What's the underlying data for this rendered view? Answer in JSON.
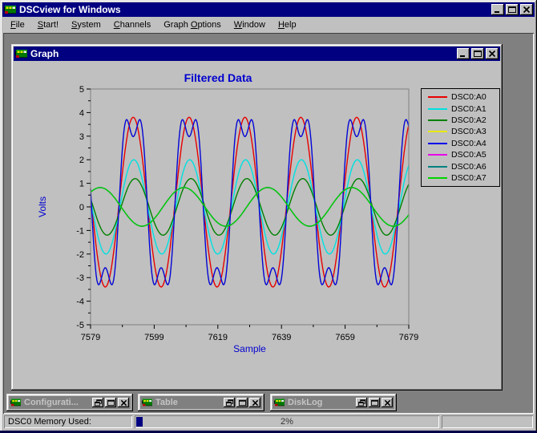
{
  "window": {
    "title": "DSCview for Windows",
    "controls": [
      "minimize",
      "maximize",
      "close"
    ]
  },
  "menu": {
    "items": [
      {
        "label": "File",
        "mnemonic": "F"
      },
      {
        "label": "Start!",
        "mnemonic": "S"
      },
      {
        "label": "System",
        "mnemonic": "S"
      },
      {
        "label": "Channels",
        "mnemonic": "C"
      },
      {
        "label": "Graph Options",
        "mnemonic": "O"
      },
      {
        "label": "Window",
        "mnemonic": "W"
      },
      {
        "label": "Help",
        "mnemonic": "H"
      }
    ]
  },
  "graph_window": {
    "title": "Graph",
    "controls": [
      "minimize",
      "maximize",
      "close"
    ]
  },
  "chart_data": {
    "type": "line",
    "title": "Filtered Data",
    "xlabel": "Sample",
    "ylabel": "Volts",
    "x_range": [
      7579,
      7679
    ],
    "y_range": [
      -5,
      5
    ],
    "x_ticks": [
      7579,
      7599,
      7619,
      7639,
      7659,
      7679
    ],
    "y_ticks": [
      -5,
      -4,
      -3,
      -2,
      -1,
      0,
      1,
      2,
      3,
      4,
      5
    ],
    "x_minor_step": 10,
    "y_minor_step": 0.5,
    "grid": false,
    "legend_position": "right",
    "plot_bg": "#c0c0c0",
    "sample_step": 0.25,
    "waveform_formula": "v(x) = dc_offset + amplitude * ( cos(2*pi*(x-peak_at_sample)/period_samples) - third_harmonic*cos(3*2*pi*(x-peak_at_sample)/period_samples) )",
    "series": [
      {
        "name": "DSC0:A0",
        "color": "#e80000",
        "amplitude": 3.6,
        "dc_offset": 0.2,
        "period_samples": 17.56,
        "peak_at_sample": 7592.4,
        "third_harmonic": 0
      },
      {
        "name": "DSC0:A1",
        "color": "#00e0e0",
        "amplitude": 2.0,
        "dc_offset": 0,
        "period_samples": 17.56,
        "peak_at_sample": 7592.6,
        "third_harmonic": 0
      },
      {
        "name": "DSC0:A2",
        "color": "#008000",
        "amplitude": 1.2,
        "dc_offset": 0,
        "period_samples": 17.56,
        "peak_at_sample": 7593.0,
        "third_harmonic": 0
      },
      {
        "name": "DSC0:A3",
        "color": "#e8e800",
        "amplitude": 3.86,
        "dc_offset": 0.2,
        "period_samples": 17.56,
        "peak_at_sample": 7592.4,
        "third_harmonic": 0.28,
        "note": "curve coincides with DSC0:A4 and is hidden beneath it"
      },
      {
        "name": "DSC0:A4",
        "color": "#0000e8",
        "amplitude": 3.86,
        "dc_offset": 0.2,
        "period_samples": 17.56,
        "peak_at_sample": 7592.4,
        "third_harmonic": 0.28
      },
      {
        "name": "DSC0:A5",
        "color": "#e800e8",
        "amplitude": 0.82,
        "dc_offset": 0,
        "period_samples": 26.34,
        "peak_at_sample": 7582.0,
        "third_harmonic": 0,
        "note": "curve coincides with DSC0:A7 and is hidden beneath it"
      },
      {
        "name": "DSC0:A6",
        "color": "#008080",
        "amplitude": 0.82,
        "dc_offset": 0,
        "period_samples": 26.34,
        "peak_at_sample": 7582.0,
        "third_harmonic": 0,
        "note": "curve coincides with DSC0:A7 and is hidden beneath it"
      },
      {
        "name": "DSC0:A7",
        "color": "#00d400",
        "amplitude": 0.82,
        "dc_offset": 0,
        "period_samples": 26.34,
        "peak_at_sample": 7582.0,
        "third_harmonic": 0
      }
    ]
  },
  "minimized_windows": [
    {
      "title": "Configurati...",
      "controls": [
        "restore",
        "maximize",
        "close"
      ]
    },
    {
      "title": "Table",
      "controls": [
        "restore",
        "maximize",
        "close"
      ]
    },
    {
      "title": "DiskLog",
      "controls": [
        "restore",
        "maximize",
        "close"
      ]
    }
  ],
  "status_bar": {
    "label": "DSC0 Memory Used:",
    "progress_percent": 2,
    "progress_text": "2%"
  }
}
